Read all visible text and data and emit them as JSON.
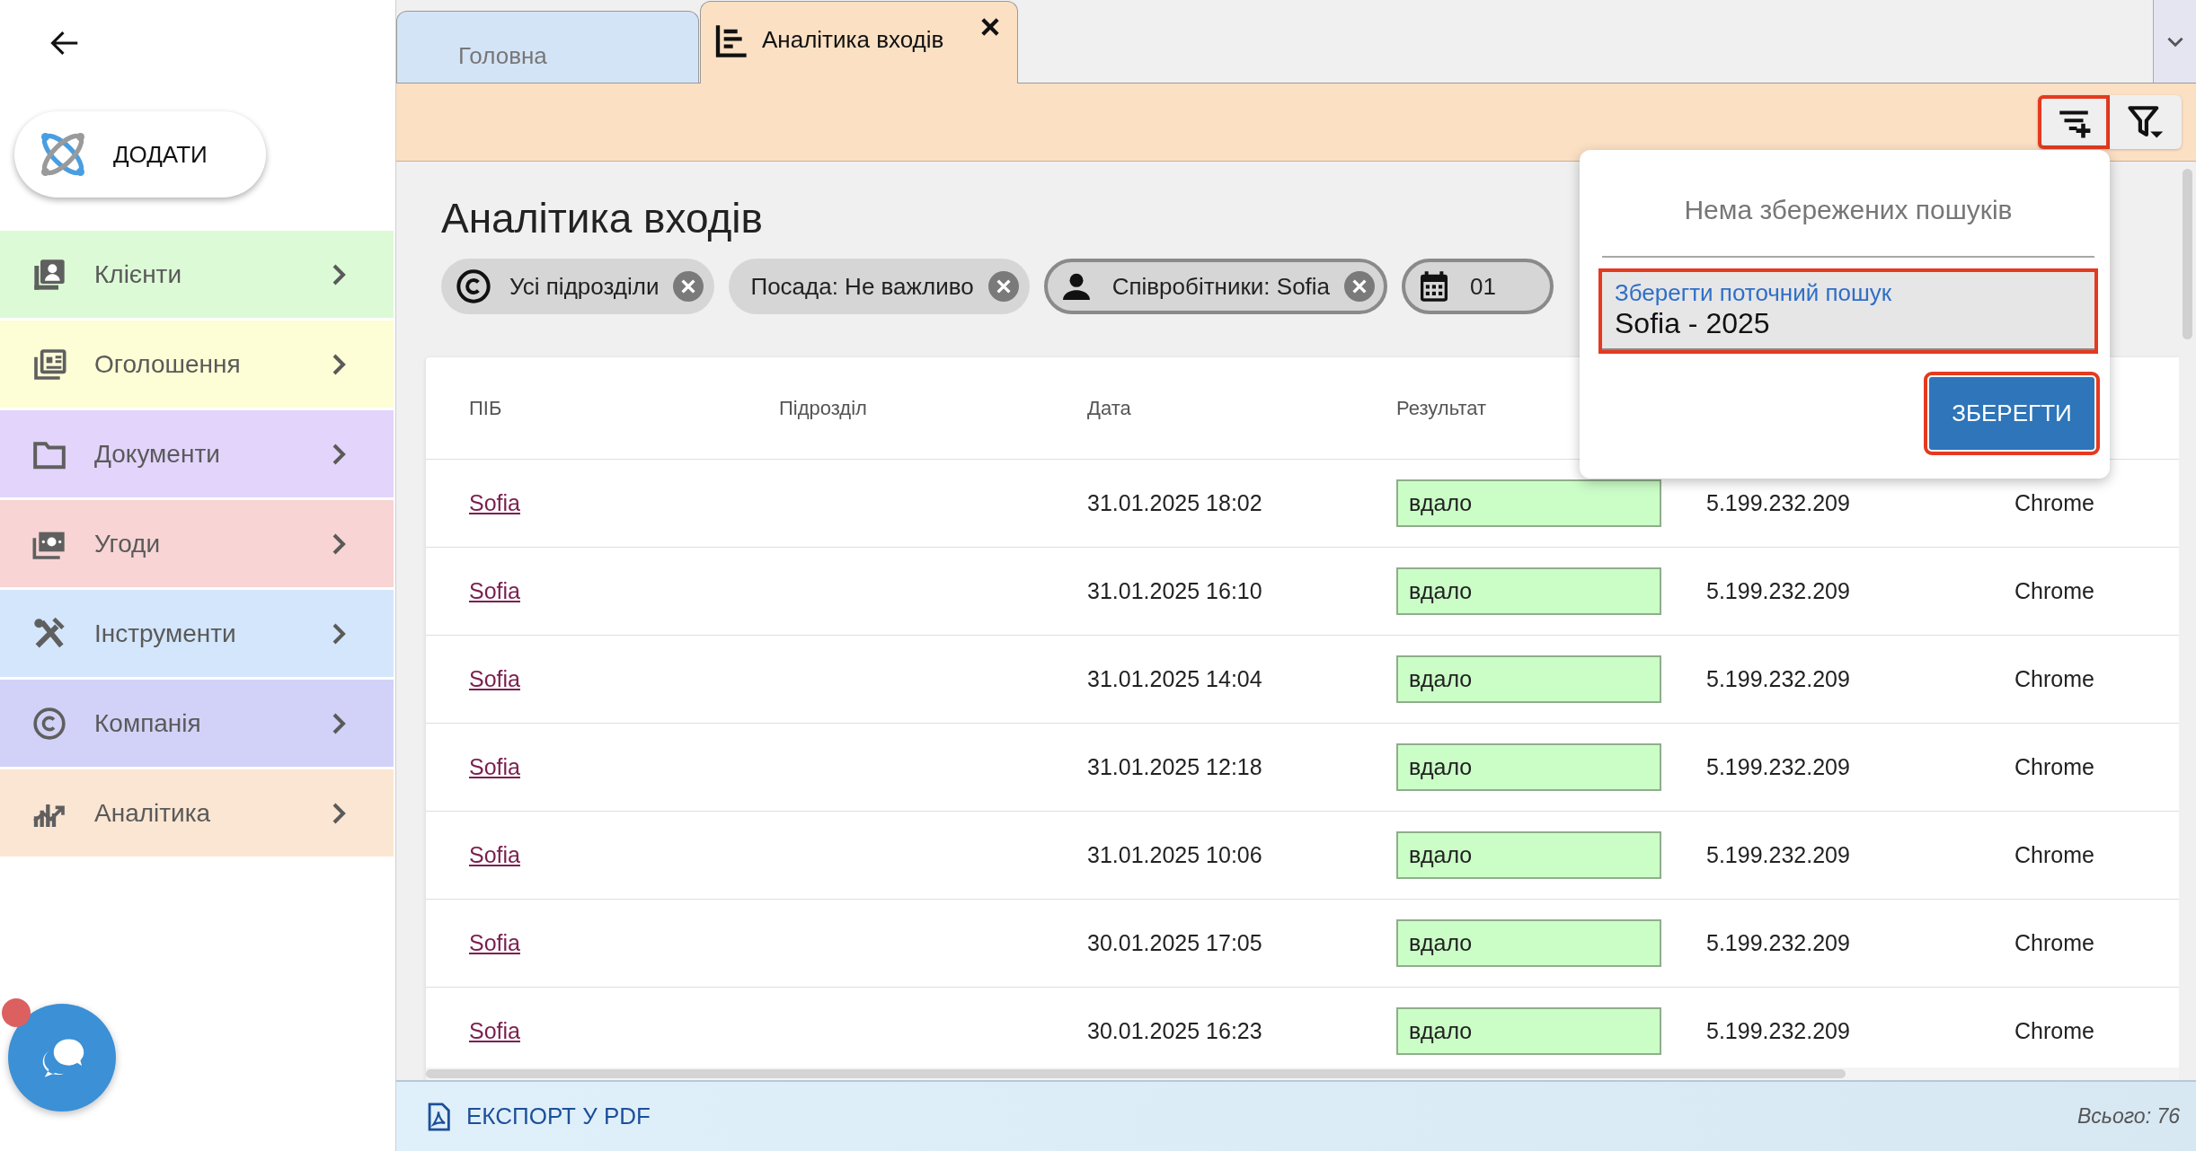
{
  "add_button": {
    "label": "ДОДАТИ"
  },
  "sidebar": {
    "items": [
      {
        "label": "Клієнти",
        "kind": "contacts",
        "color": "#dcfad6"
      },
      {
        "label": "Оголошення",
        "kind": "ads",
        "color": "#fdfdd6"
      },
      {
        "label": "Документи",
        "kind": "folder",
        "color": "#e3d4fb"
      },
      {
        "label": "Угоди",
        "kind": "money",
        "color": "#f8d4d4"
      },
      {
        "label": "Інструменти",
        "kind": "tools",
        "color": "#d4e6fb"
      },
      {
        "label": "Компанія",
        "kind": "company",
        "color": "#d2d2f8"
      },
      {
        "label": "Аналітика",
        "kind": "analytics",
        "color": "#fae6d2"
      }
    ]
  },
  "chat": {
    "notification": true
  },
  "tabs": [
    {
      "label": "Головна",
      "selected": false,
      "closable": false
    },
    {
      "label": "Аналітика входів",
      "selected": true,
      "closable": true
    }
  ],
  "toolbar": {
    "buttons": [
      {
        "kind": "save-search",
        "highlighted": true
      },
      {
        "kind": "filter-menu",
        "highlighted": false
      }
    ]
  },
  "page": {
    "title": "Аналітика входів",
    "filters": [
      {
        "kind": "company",
        "label": "Усі підрозділи",
        "outlined": false,
        "removable": true
      },
      {
        "kind": "plain",
        "label": "Посада: Не важливо",
        "outlined": false,
        "removable": true
      },
      {
        "kind": "person",
        "label": "Співробітники: Sofia",
        "outlined": true,
        "removable": true
      },
      {
        "kind": "calendar",
        "label": "01",
        "outlined": true,
        "removable": false
      }
    ]
  },
  "table": {
    "columns": [
      "ПІБ",
      "Підрозділ",
      "Дата",
      "Результат"
    ],
    "rows": [
      {
        "name": "Sofia",
        "date": "31.01.2025 18:02",
        "result": "вдало",
        "column_5": "5.199.232.209",
        "column_6": "Chrome"
      },
      {
        "name": "Sofia",
        "date": "31.01.2025 16:10",
        "result": "вдало",
        "column_5": "5.199.232.209",
        "column_6": "Chrome"
      },
      {
        "name": "Sofia",
        "date": "31.01.2025 14:04",
        "result": "вдало",
        "column_5": "5.199.232.209",
        "column_6": "Chrome"
      },
      {
        "name": "Sofia",
        "date": "31.01.2025 12:18",
        "result": "вдало",
        "column_5": "5.199.232.209",
        "column_6": "Chrome"
      },
      {
        "name": "Sofia",
        "date": "31.01.2025 10:06",
        "result": "вдало",
        "column_5": "5.199.232.209",
        "column_6": "Chrome"
      },
      {
        "name": "Sofia",
        "date": "30.01.2025 17:05",
        "result": "вдало",
        "column_5": "5.199.232.209",
        "column_6": "Chrome"
      },
      {
        "name": "Sofia",
        "date": "30.01.2025 16:23",
        "result": "вдало",
        "column_5": "5.199.232.209",
        "column_6": "Chrome"
      }
    ]
  },
  "footer": {
    "export_label": "ЕКСПОРТ У PDF",
    "total": "Всього: 76"
  },
  "popup": {
    "message": "Нема збережених пошуків",
    "field": {
      "label": "Зберегти поточний пошук",
      "value": "Sofia - 2025",
      "highlighted": true
    },
    "button": {
      "label": "ЗБЕРЕГТИ",
      "highlighted": true
    }
  }
}
